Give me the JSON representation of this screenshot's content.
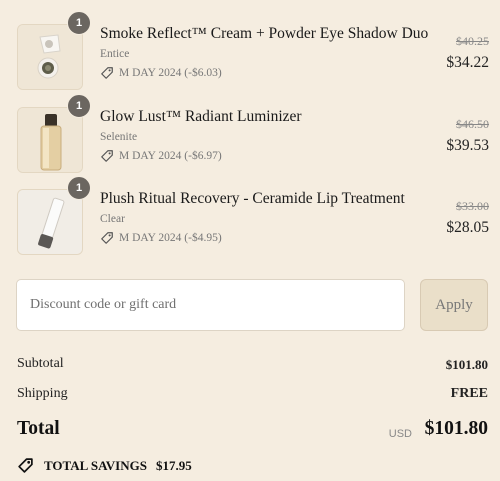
{
  "items": [
    {
      "quantity": "1",
      "name": "Smoke Reflect™ Cream + Powder Eye Shadow Duo",
      "variant": "Entice",
      "discount": "M DAY 2024 (-$6.03)",
      "original_price": "$40.25",
      "price": "$34.22",
      "thumbnail": "eyeshadow-duo-image"
    },
    {
      "quantity": "1",
      "name": "Glow Lust™ Radiant Luminizer",
      "variant": "Selenite",
      "discount": "M DAY 2024 (-$6.97)",
      "original_price": "$46.50",
      "price": "$39.53",
      "thumbnail": "luminizer-bottle-image"
    },
    {
      "quantity": "1",
      "name": "Plush Ritual Recovery - Ceramide Lip Treatment",
      "variant": "Clear",
      "discount": "M DAY 2024 (-$4.95)",
      "original_price": "$33.00",
      "price": "$28.05",
      "thumbnail": "lip-treatment-tube-image"
    }
  ],
  "discount_code": {
    "placeholder": "Discount code or gift card",
    "value": "",
    "apply_label": "Apply"
  },
  "summary": {
    "subtotal_label": "Subtotal",
    "subtotal_value": "$101.80",
    "shipping_label": "Shipping",
    "shipping_value": "FREE",
    "total_label": "Total",
    "currency": "USD",
    "total_value": "$101.80",
    "savings_label": "TOTAL SAVINGS",
    "savings_value": "$17.95"
  },
  "colors": {
    "background": "#f5ede0",
    "badge": "#6b6660",
    "apply_button": "#eadfc9"
  }
}
